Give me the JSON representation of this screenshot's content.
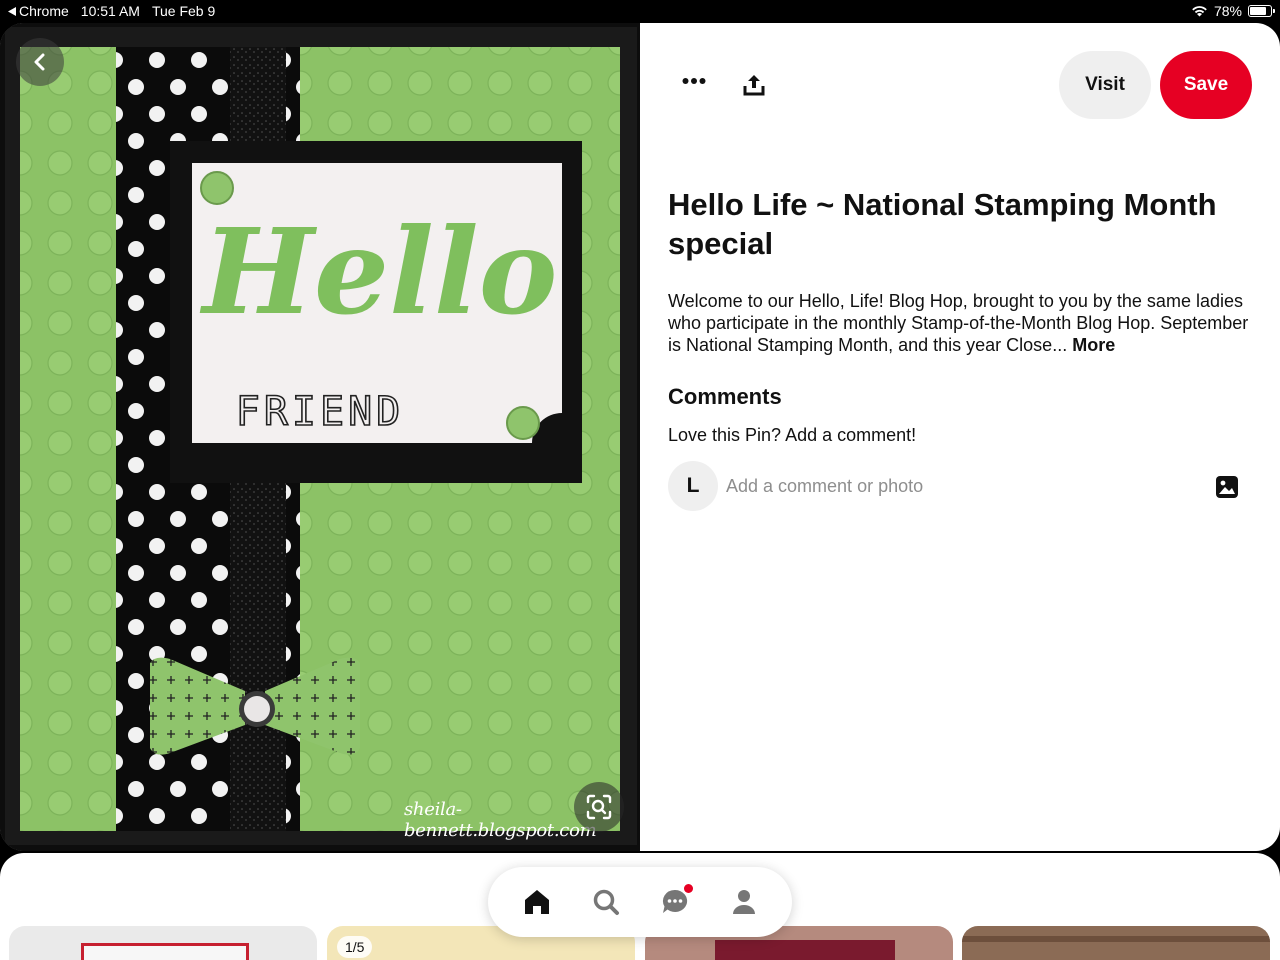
{
  "status_bar": {
    "back_app": "Chrome",
    "time": "10:51 AM",
    "date": "Tue Feb 9",
    "battery": "78%",
    "battery_level": 0.78
  },
  "pin": {
    "image_text": {
      "greeting": "Hello",
      "friend": "FRIEND",
      "watermark": "sheila-bennett.blogspot.com"
    },
    "actions": {
      "visit_label": "Visit",
      "save_label": "Save"
    },
    "title": "Hello Life ~ National Stamping Month special",
    "description": "Welcome to our Hello, Life! Blog Hop, brought to you by the same ladies who participate in the monthly Stamp-of-the-Month Blog Hop. September is National Stamping Month, and this year Close...",
    "more_label": "More"
  },
  "comments": {
    "heading": "Comments",
    "prompt": "Love this Pin? Add a comment!",
    "avatar_initial": "L",
    "placeholder": "Add a comment or photo"
  },
  "related": {
    "badge": "1/5"
  },
  "icons": {
    "back": "chevron-left-icon",
    "more": "ellipsis-icon",
    "share": "share-icon",
    "lens": "visual-search-icon",
    "photo": "photo-icon",
    "tabs": [
      "home-icon",
      "search-icon",
      "messages-icon",
      "profile-icon"
    ]
  },
  "colors": {
    "save": "#e60023",
    "card_green": "#8cc266",
    "notification": "#e60023"
  }
}
